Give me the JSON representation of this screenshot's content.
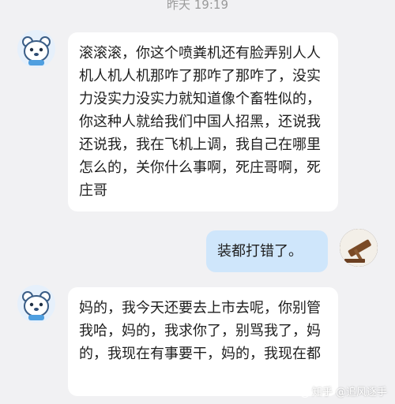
{
  "chat": {
    "timestamp": "昨天 19:19",
    "messages": [
      {
        "sender": "other",
        "avatar_icon": "robot-bear-avatar",
        "text": "滚滚滚，你这个喷粪机还有脸弄别人人机人机人机那咋了那咋了那咋了，没实力没实力没实力就知道像个畜牲似的，你这种人就给我们中国人招黑，还说我还说我，我在飞机上调，我自己在哪里怎么的，关你什么事啊，死庄哥啊，死庄哥"
      },
      {
        "sender": "self",
        "avatar_icon": "gavel-avatar",
        "text": "装都打错了。"
      },
      {
        "sender": "other",
        "avatar_icon": "robot-bear-avatar",
        "text": "妈的，我今天还要去上市去呢，你别管我哈，妈的，我求你了，别骂我了，妈的，我现在有事要干，妈的，我现在都"
      }
    ]
  },
  "watermark": "知乎 @追风逐手",
  "colors": {
    "background": "#f1f1f3",
    "bubble_other": "#ffffff",
    "bubble_self": "#cfe6fb",
    "text": "#1f1f1f",
    "timestamp": "#9a9a9a"
  }
}
